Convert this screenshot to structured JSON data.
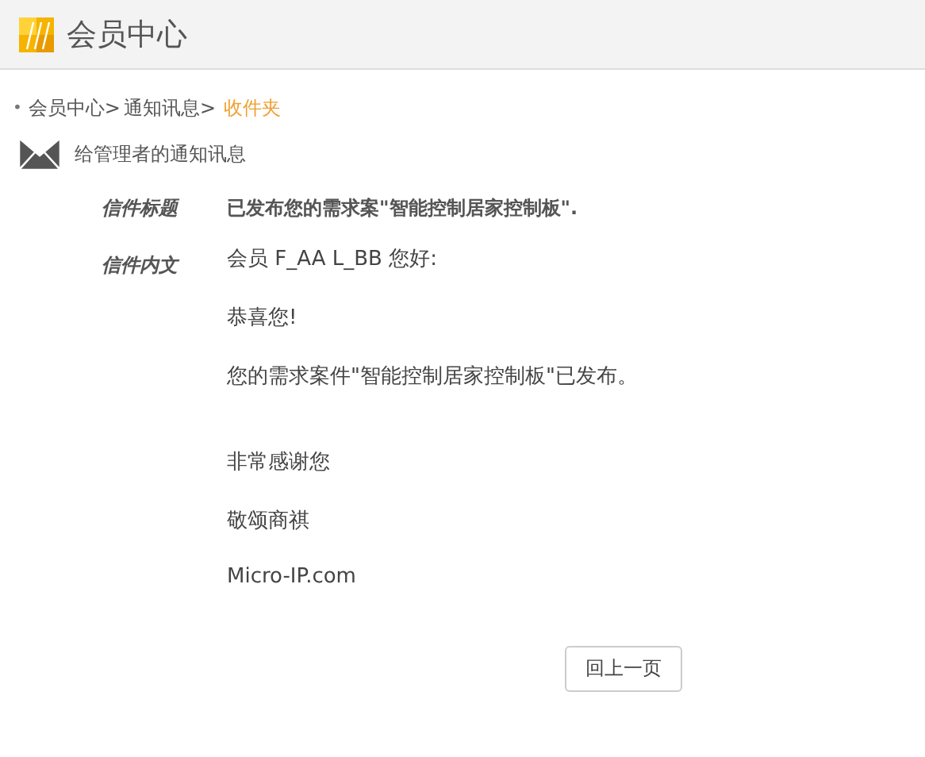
{
  "header": {
    "title": "会员中心"
  },
  "breadcrumb": {
    "bullet": "•",
    "items": [
      {
        "label": "会员中心>",
        "current": false
      },
      {
        "label": "通知讯息>",
        "current": false
      },
      {
        "label": "收件夹",
        "current": true
      }
    ]
  },
  "section_title": "给管理者的通知讯息",
  "message": {
    "subject_label": "信件标题",
    "subject": "已发布您的需求案\"智能控制居家控制板\".",
    "body_label": "信件内文",
    "body": [
      {
        "lines": [
          "会员 F_AA L_BB 您好:",
          "恭喜您!",
          "您的需求案件\"智能控制居家控制板\"已发布。"
        ]
      },
      {
        "lines": [
          "非常感谢您",
          "敬颂商祺",
          "Micro-IP.com"
        ]
      }
    ]
  },
  "back_button": "回上一页"
}
